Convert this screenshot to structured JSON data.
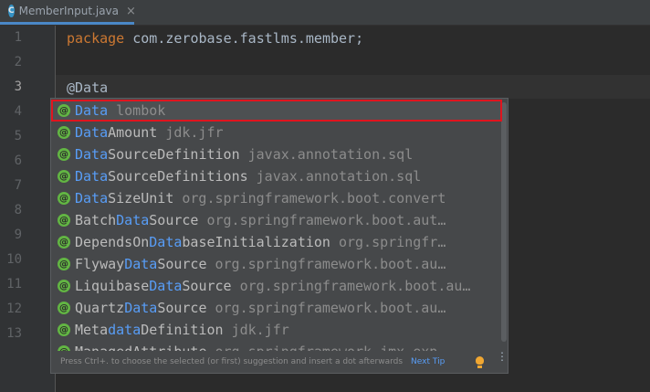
{
  "tab": {
    "icon_letter": "C",
    "label": "MemberInput.java",
    "close": "×"
  },
  "gutter": {
    "line_numbers": [
      "1",
      "2",
      "3",
      "4",
      "5",
      "6",
      "7",
      "8",
      "9",
      "10",
      "11",
      "12",
      "13"
    ]
  },
  "code": {
    "line1": {
      "keyword": "package",
      "rest": " com.zerobase.fastlms.member;"
    },
    "line3": {
      "annotation": "@Data"
    }
  },
  "completion": {
    "icon_letter": "@",
    "items": [
      {
        "pre": "",
        "hl": "Data",
        "post": "",
        "pkg": "lombok"
      },
      {
        "pre": "",
        "hl": "Data",
        "post": "Amount",
        "pkg": "jdk.jfr"
      },
      {
        "pre": "",
        "hl": "Data",
        "post": "SourceDefinition",
        "pkg": "javax.annotation.sql"
      },
      {
        "pre": "",
        "hl": "Data",
        "post": "SourceDefinitions",
        "pkg": "javax.annotation.sql"
      },
      {
        "pre": "",
        "hl": "Data",
        "post": "SizeUnit",
        "pkg": "org.springframework.boot.convert"
      },
      {
        "pre": "Batch",
        "hl": "Data",
        "post": "Source",
        "pkg": "org.springframework.boot.aut…"
      },
      {
        "pre": "DependsOn",
        "hl": "Data",
        "post": "baseInitialization",
        "pkg": "org.springfr…"
      },
      {
        "pre": "Flyway",
        "hl": "Data",
        "post": "Source",
        "pkg": "org.springframework.boot.au…"
      },
      {
        "pre": "Liquibase",
        "hl": "Data",
        "post": "Source",
        "pkg": "org.springframework.boot.au…"
      },
      {
        "pre": "Quartz",
        "hl": "Data",
        "post": "Source",
        "pkg": "org.springframework.boot.au…"
      },
      {
        "pre": "Meta",
        "hl": "data",
        "post": "Definition",
        "pkg": "jdk.jfr"
      },
      {
        "pre": "ManagedAttribute",
        "hl": "",
        "post": "",
        "pkg": "org.springframework.jmx.exp…"
      }
    ],
    "footer": {
      "hint": "Press Ctrl+. to choose the selected (or first) suggestion and insert a dot afterwards",
      "next_tip": "Next Tip",
      "more": "⋮"
    }
  },
  "colors": {
    "editor_bg": "#2b2b2b",
    "popup_bg": "#46484a",
    "match_highlight": "#589df6",
    "selection_outline": "#e0141e",
    "keyword": "#cc7832",
    "annotation": "#bbb529"
  }
}
